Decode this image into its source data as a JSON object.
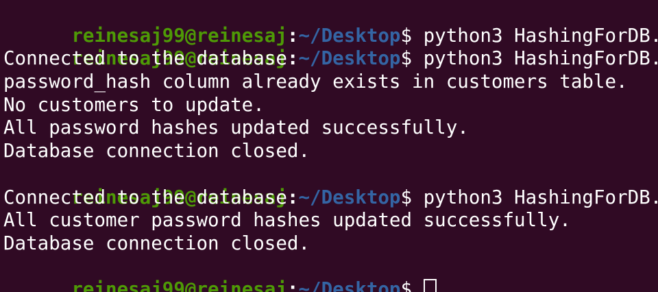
{
  "colors": {
    "background": "#300a24",
    "user_host": "#4e9a06",
    "path": "#3465a4",
    "text": "#ffffff"
  },
  "prompt": {
    "user_host": "reinesaj99@reinesaj",
    "colon": ":",
    "path": "~/Desktop",
    "dollar": "$"
  },
  "lines": [
    {
      "type": "prompt",
      "command": " python3 HashingForDB.py"
    },
    {
      "type": "prompt",
      "command": " python3 HashingForDB.py"
    },
    {
      "type": "output",
      "text": "Connected to the database."
    },
    {
      "type": "output",
      "text": "password_hash column already exists in customers table."
    },
    {
      "type": "output",
      "text": "No customers to update."
    },
    {
      "type": "output",
      "text": "All password hashes updated successfully."
    },
    {
      "type": "output",
      "text": "Database connection closed."
    },
    {
      "type": "prompt",
      "command": " python3 HashingForDB.py"
    },
    {
      "type": "output",
      "text": "Connected to the database."
    },
    {
      "type": "output",
      "text": "All customer password hashes updated successfully."
    },
    {
      "type": "output",
      "text": "Database connection closed."
    },
    {
      "type": "prompt",
      "command": " ",
      "cursor": true
    }
  ]
}
